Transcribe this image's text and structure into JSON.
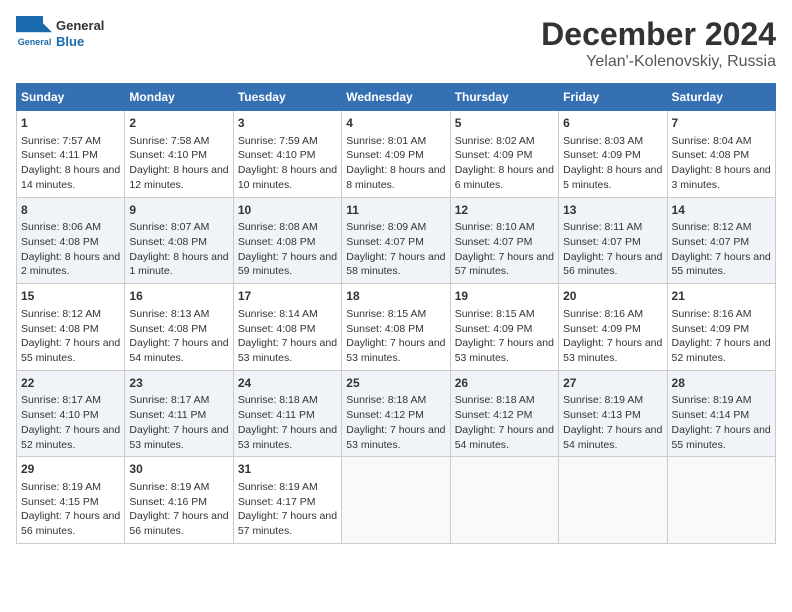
{
  "header": {
    "logo_line1": "General",
    "logo_line2": "Blue",
    "title": "December 2024",
    "subtitle": "Yelan'-Kolenovskiy, Russia"
  },
  "calendar": {
    "days_of_week": [
      "Sunday",
      "Monday",
      "Tuesday",
      "Wednesday",
      "Thursday",
      "Friday",
      "Saturday"
    ],
    "weeks": [
      [
        {
          "day": "1",
          "sunrise": "Sunrise: 7:57 AM",
          "sunset": "Sunset: 4:11 PM",
          "daylight": "Daylight: 8 hours and 14 minutes."
        },
        {
          "day": "2",
          "sunrise": "Sunrise: 7:58 AM",
          "sunset": "Sunset: 4:10 PM",
          "daylight": "Daylight: 8 hours and 12 minutes."
        },
        {
          "day": "3",
          "sunrise": "Sunrise: 7:59 AM",
          "sunset": "Sunset: 4:10 PM",
          "daylight": "Daylight: 8 hours and 10 minutes."
        },
        {
          "day": "4",
          "sunrise": "Sunrise: 8:01 AM",
          "sunset": "Sunset: 4:09 PM",
          "daylight": "Daylight: 8 hours and 8 minutes."
        },
        {
          "day": "5",
          "sunrise": "Sunrise: 8:02 AM",
          "sunset": "Sunset: 4:09 PM",
          "daylight": "Daylight: 8 hours and 6 minutes."
        },
        {
          "day": "6",
          "sunrise": "Sunrise: 8:03 AM",
          "sunset": "Sunset: 4:09 PM",
          "daylight": "Daylight: 8 hours and 5 minutes."
        },
        {
          "day": "7",
          "sunrise": "Sunrise: 8:04 AM",
          "sunset": "Sunset: 4:08 PM",
          "daylight": "Daylight: 8 hours and 3 minutes."
        }
      ],
      [
        {
          "day": "8",
          "sunrise": "Sunrise: 8:06 AM",
          "sunset": "Sunset: 4:08 PM",
          "daylight": "Daylight: 8 hours and 2 minutes."
        },
        {
          "day": "9",
          "sunrise": "Sunrise: 8:07 AM",
          "sunset": "Sunset: 4:08 PM",
          "daylight": "Daylight: 8 hours and 1 minute."
        },
        {
          "day": "10",
          "sunrise": "Sunrise: 8:08 AM",
          "sunset": "Sunset: 4:08 PM",
          "daylight": "Daylight: 7 hours and 59 minutes."
        },
        {
          "day": "11",
          "sunrise": "Sunrise: 8:09 AM",
          "sunset": "Sunset: 4:07 PM",
          "daylight": "Daylight: 7 hours and 58 minutes."
        },
        {
          "day": "12",
          "sunrise": "Sunrise: 8:10 AM",
          "sunset": "Sunset: 4:07 PM",
          "daylight": "Daylight: 7 hours and 57 minutes."
        },
        {
          "day": "13",
          "sunrise": "Sunrise: 8:11 AM",
          "sunset": "Sunset: 4:07 PM",
          "daylight": "Daylight: 7 hours and 56 minutes."
        },
        {
          "day": "14",
          "sunrise": "Sunrise: 8:12 AM",
          "sunset": "Sunset: 4:07 PM",
          "daylight": "Daylight: 7 hours and 55 minutes."
        }
      ],
      [
        {
          "day": "15",
          "sunrise": "Sunrise: 8:12 AM",
          "sunset": "Sunset: 4:08 PM",
          "daylight": "Daylight: 7 hours and 55 minutes."
        },
        {
          "day": "16",
          "sunrise": "Sunrise: 8:13 AM",
          "sunset": "Sunset: 4:08 PM",
          "daylight": "Daylight: 7 hours and 54 minutes."
        },
        {
          "day": "17",
          "sunrise": "Sunrise: 8:14 AM",
          "sunset": "Sunset: 4:08 PM",
          "daylight": "Daylight: 7 hours and 53 minutes."
        },
        {
          "day": "18",
          "sunrise": "Sunrise: 8:15 AM",
          "sunset": "Sunset: 4:08 PM",
          "daylight": "Daylight: 7 hours and 53 minutes."
        },
        {
          "day": "19",
          "sunrise": "Sunrise: 8:15 AM",
          "sunset": "Sunset: 4:09 PM",
          "daylight": "Daylight: 7 hours and 53 minutes."
        },
        {
          "day": "20",
          "sunrise": "Sunrise: 8:16 AM",
          "sunset": "Sunset: 4:09 PM",
          "daylight": "Daylight: 7 hours and 53 minutes."
        },
        {
          "day": "21",
          "sunrise": "Sunrise: 8:16 AM",
          "sunset": "Sunset: 4:09 PM",
          "daylight": "Daylight: 7 hours and 52 minutes."
        }
      ],
      [
        {
          "day": "22",
          "sunrise": "Sunrise: 8:17 AM",
          "sunset": "Sunset: 4:10 PM",
          "daylight": "Daylight: 7 hours and 52 minutes."
        },
        {
          "day": "23",
          "sunrise": "Sunrise: 8:17 AM",
          "sunset": "Sunset: 4:11 PM",
          "daylight": "Daylight: 7 hours and 53 minutes."
        },
        {
          "day": "24",
          "sunrise": "Sunrise: 8:18 AM",
          "sunset": "Sunset: 4:11 PM",
          "daylight": "Daylight: 7 hours and 53 minutes."
        },
        {
          "day": "25",
          "sunrise": "Sunrise: 8:18 AM",
          "sunset": "Sunset: 4:12 PM",
          "daylight": "Daylight: 7 hours and 53 minutes."
        },
        {
          "day": "26",
          "sunrise": "Sunrise: 8:18 AM",
          "sunset": "Sunset: 4:12 PM",
          "daylight": "Daylight: 7 hours and 54 minutes."
        },
        {
          "day": "27",
          "sunrise": "Sunrise: 8:19 AM",
          "sunset": "Sunset: 4:13 PM",
          "daylight": "Daylight: 7 hours and 54 minutes."
        },
        {
          "day": "28",
          "sunrise": "Sunrise: 8:19 AM",
          "sunset": "Sunset: 4:14 PM",
          "daylight": "Daylight: 7 hours and 55 minutes."
        }
      ],
      [
        {
          "day": "29",
          "sunrise": "Sunrise: 8:19 AM",
          "sunset": "Sunset: 4:15 PM",
          "daylight": "Daylight: 7 hours and 56 minutes."
        },
        {
          "day": "30",
          "sunrise": "Sunrise: 8:19 AM",
          "sunset": "Sunset: 4:16 PM",
          "daylight": "Daylight: 7 hours and 56 minutes."
        },
        {
          "day": "31",
          "sunrise": "Sunrise: 8:19 AM",
          "sunset": "Sunset: 4:17 PM",
          "daylight": "Daylight: 7 hours and 57 minutes."
        },
        null,
        null,
        null,
        null
      ]
    ]
  }
}
